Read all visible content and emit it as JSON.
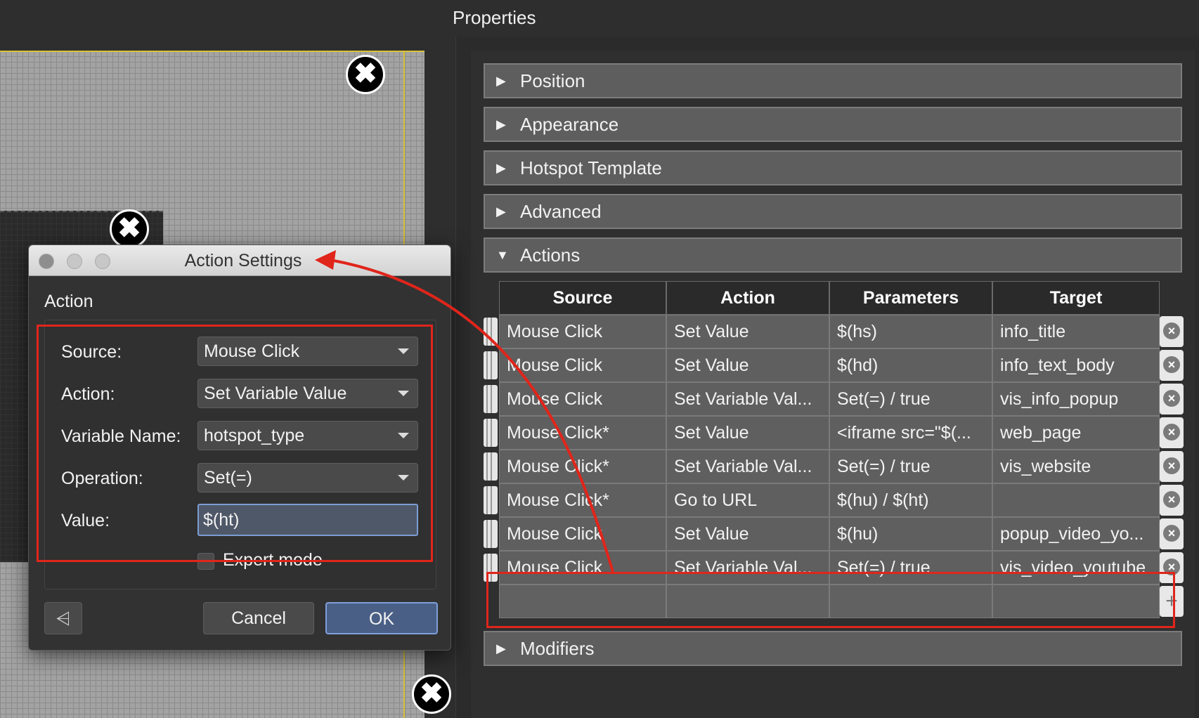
{
  "properties": {
    "title": "Properties",
    "sections_top": [
      {
        "label": "Position",
        "expanded": false
      },
      {
        "label": "Appearance",
        "expanded": false
      },
      {
        "label": "Hotspot Template",
        "expanded": false
      },
      {
        "label": "Advanced",
        "expanded": false
      },
      {
        "label": "Actions",
        "expanded": true
      }
    ],
    "modifiers_label": "Modifiers"
  },
  "actions_table": {
    "headers": [
      "Source",
      "Action",
      "Parameters",
      "Target"
    ],
    "rows": [
      [
        "Mouse Click",
        "Set Value",
        "$(hs)",
        "info_title"
      ],
      [
        "Mouse Click",
        "Set Value",
        "$(hd)",
        "info_text_body"
      ],
      [
        "Mouse Click",
        "Set Variable Val...",
        "Set(=) / true",
        "vis_info_popup"
      ],
      [
        "Mouse Click*",
        "Set Value",
        "<iframe src=\"$(...",
        "web_page"
      ],
      [
        "Mouse Click*",
        "Set Variable Val...",
        "Set(=) / true",
        "vis_website"
      ],
      [
        "Mouse Click*",
        "Go to URL",
        "$(hu) / $(ht)",
        ""
      ],
      [
        "Mouse Click",
        "Set Value",
        "$(hu)",
        "popup_video_yo..."
      ],
      [
        "Mouse Click",
        "Set Variable Val...",
        "Set(=) / true",
        "vis_video_youtube"
      ]
    ],
    "add_glyph": "+"
  },
  "dialog": {
    "title": "Action Settings",
    "group_label": "Action",
    "fields": {
      "source": {
        "label": "Source:",
        "value": "Mouse Click"
      },
      "action": {
        "label": "Action:",
        "value": "Set Variable Value"
      },
      "variable": {
        "label": "Variable Name:",
        "value": "hotspot_type"
      },
      "operation": {
        "label": "Operation:",
        "value": "Set(=)"
      },
      "value": {
        "label": "Value:",
        "value": "$(ht)"
      }
    },
    "expert_mode": {
      "label": "Expert mode",
      "checked": false
    },
    "cancel_label": "Cancel",
    "ok_label": "OK"
  },
  "icons": {
    "hotspot_close": "✖",
    "expand_closed": "▶",
    "expand_open": "▼",
    "delete_row": "×",
    "share": "⩤"
  },
  "colors": {
    "annotation_red": "#e0251b",
    "guide_yellow": "#d9c23a",
    "ok_blue": "#4a5f86"
  }
}
